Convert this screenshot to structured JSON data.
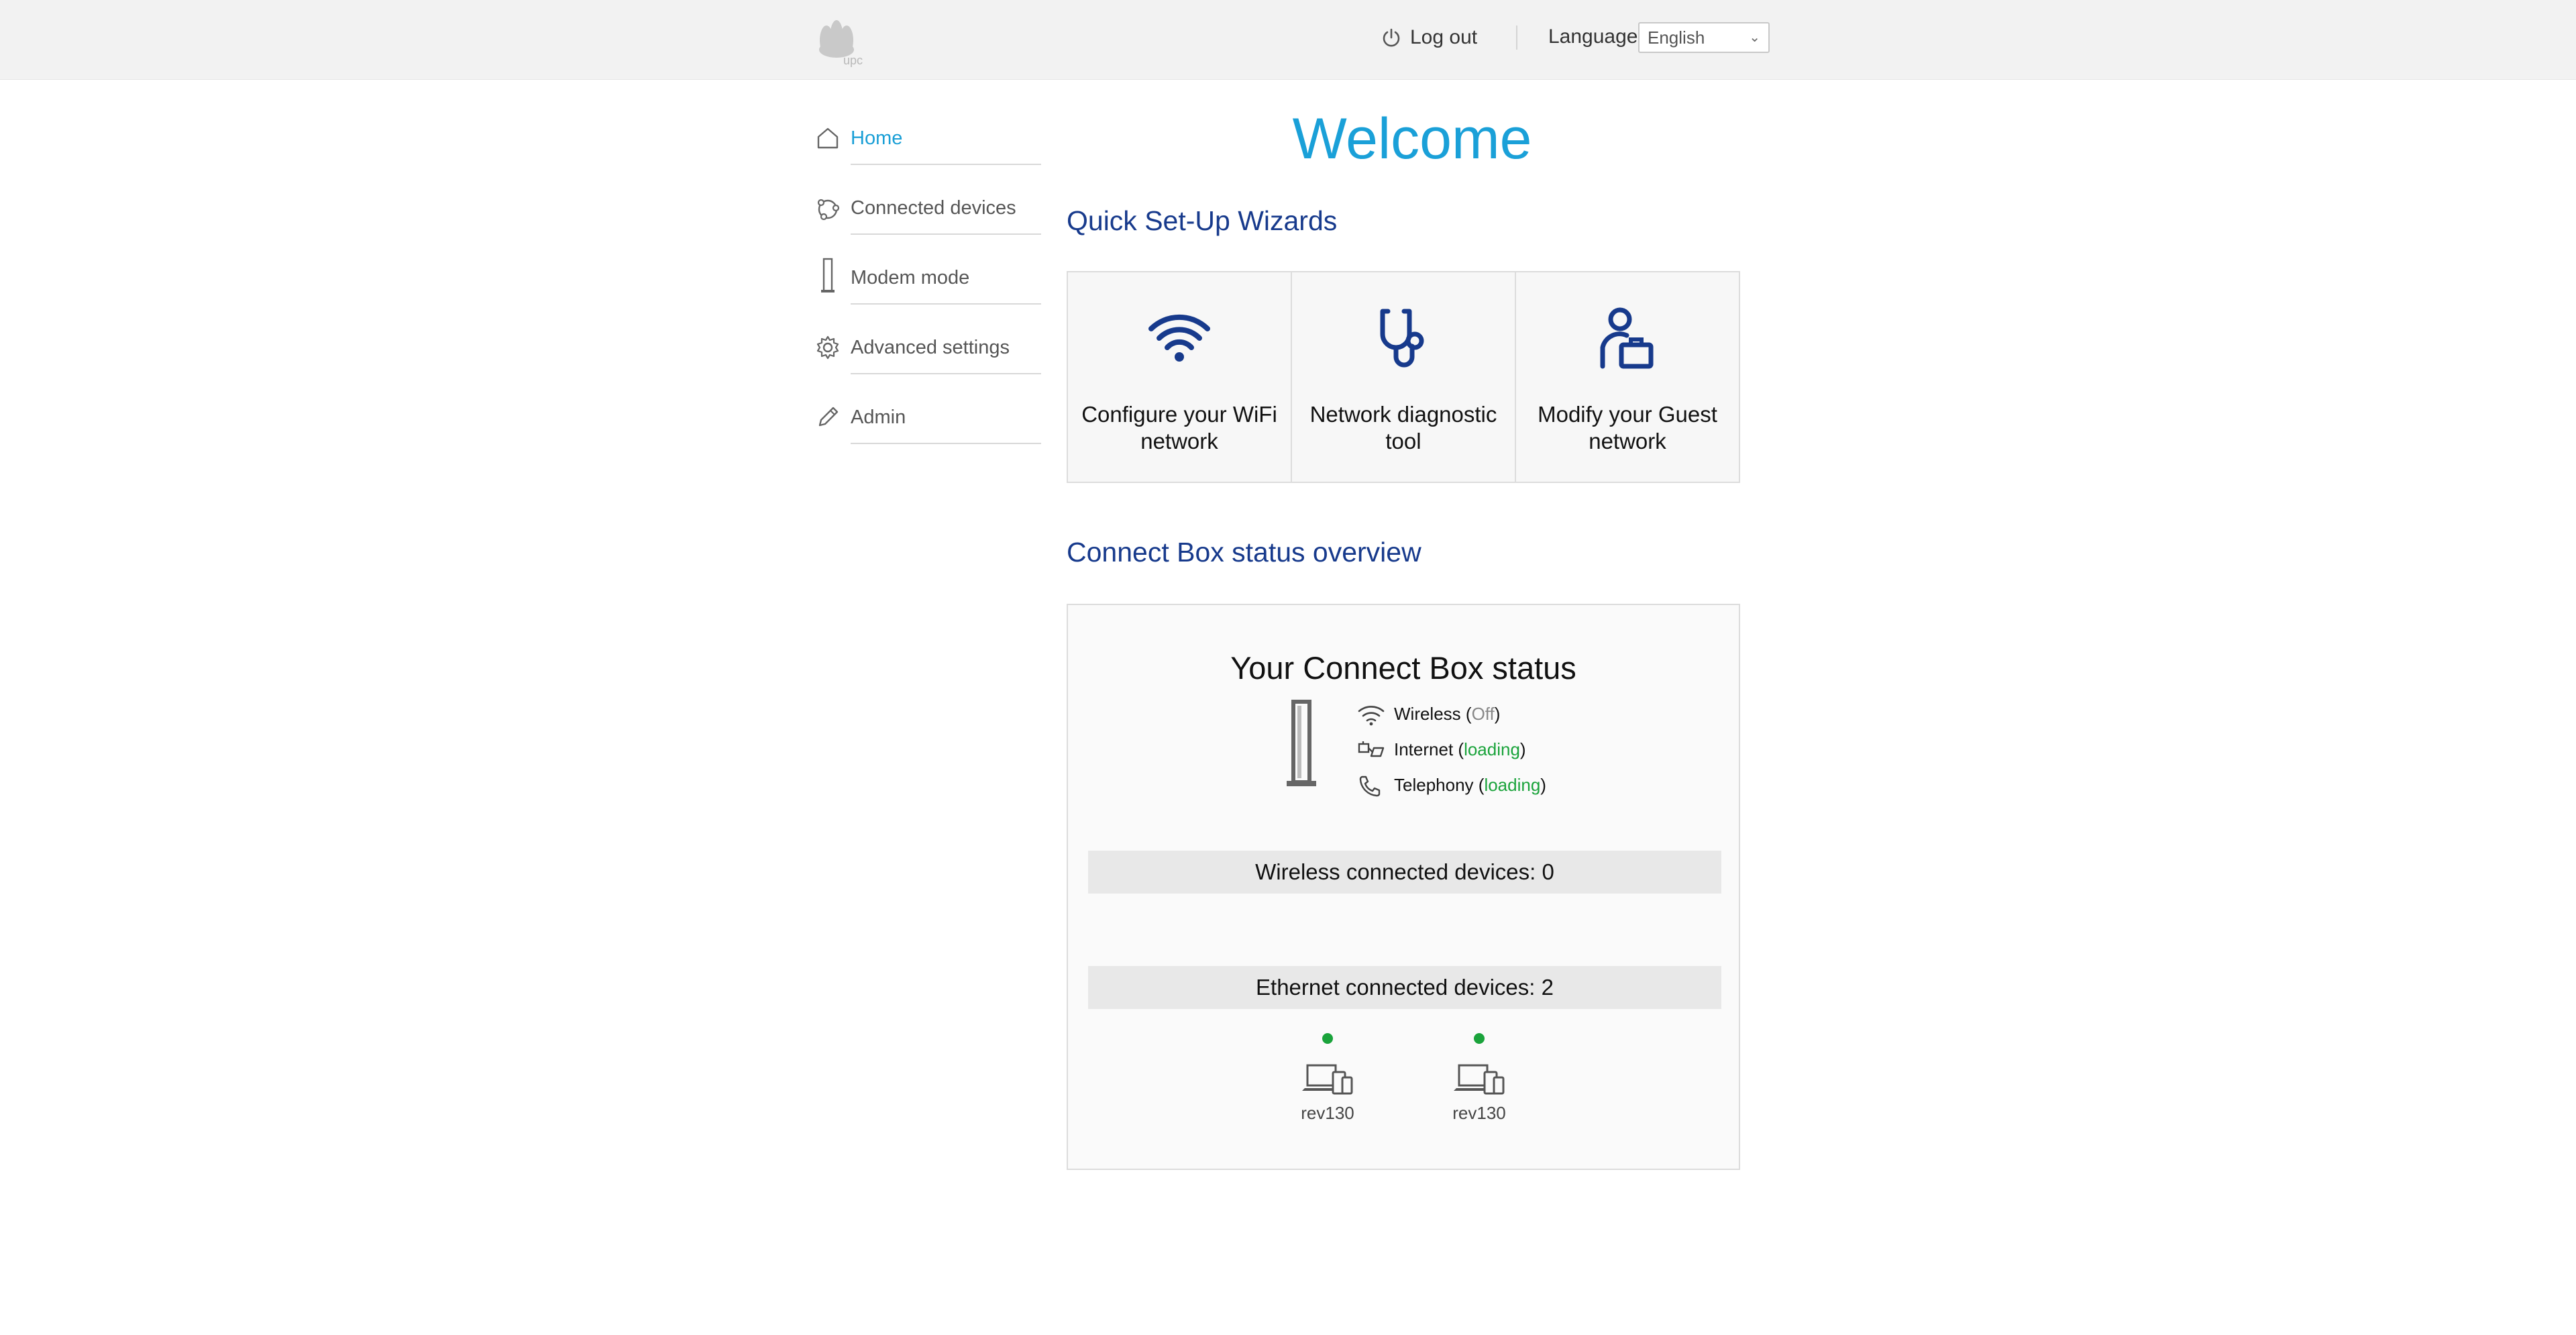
{
  "header": {
    "logo_text": "upc",
    "logout_label": "Log out",
    "language_label": "Language",
    "language_value": "English"
  },
  "sidebar": {
    "items": [
      {
        "label": "Home",
        "icon": "home-icon",
        "active": true
      },
      {
        "label": "Connected devices",
        "icon": "devices-icon",
        "active": false
      },
      {
        "label": "Modem mode",
        "icon": "modem-icon",
        "active": false
      },
      {
        "label": "Advanced settings",
        "icon": "gear-icon",
        "active": false
      },
      {
        "label": "Admin",
        "icon": "pencil-icon",
        "active": false
      }
    ]
  },
  "main": {
    "welcome": "Welcome",
    "wizards_title": "Quick Set-Up Wizards",
    "wizards": [
      {
        "label": "Configure your WiFi network",
        "icon": "wifi-icon"
      },
      {
        "label": "Network diagnostic tool",
        "icon": "stethoscope-icon"
      },
      {
        "label": "Modify your Guest network",
        "icon": "guest-icon"
      }
    ],
    "overview_title": "Connect Box status overview",
    "status": {
      "title": "Your Connect Box status",
      "rows": [
        {
          "name": "Wireless",
          "state": "Off",
          "icon": "wifi-icon"
        },
        {
          "name": "Internet",
          "state": "loading",
          "icon": "internet-icon"
        },
        {
          "name": "Telephony",
          "state": "loading",
          "icon": "phone-icon"
        }
      ],
      "wireless_devices_label": "Wireless connected devices: 0",
      "ethernet_devices_label": "Ethernet connected devices: 2",
      "ethernet_devices": [
        {
          "name": "rev130",
          "online": true
        },
        {
          "name": "rev130",
          "online": true
        }
      ]
    }
  },
  "colors": {
    "accent": "#1aa0d8",
    "heading": "#173a8c",
    "online": "#1aa33b"
  }
}
